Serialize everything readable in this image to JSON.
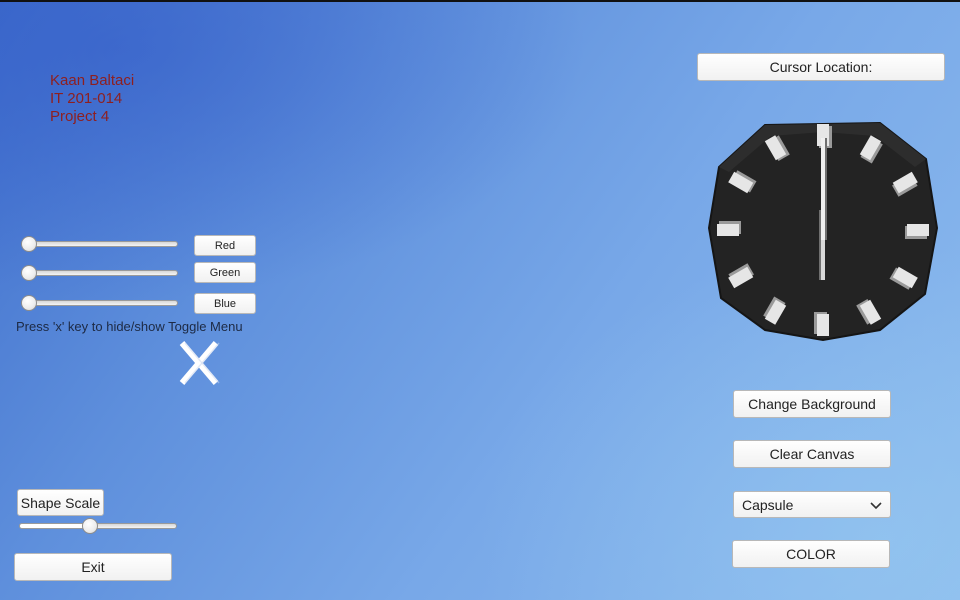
{
  "author": {
    "name": "Kaan Baltaci",
    "course": "IT 201-014",
    "project": "Project 4"
  },
  "color_sliders": [
    {
      "label": "Red",
      "value": 0
    },
    {
      "label": "Green",
      "value": 0
    },
    {
      "label": "Blue",
      "value": 0
    }
  ],
  "hint_text": "Press 'x' key to hide/show Toggle Menu",
  "shape_scale": {
    "label": "Shape Scale",
    "value": 0.45
  },
  "exit_label": "Exit",
  "cursor_location_label": "Cursor Location:",
  "buttons": {
    "change_background": "Change Background",
    "clear_canvas": "Clear Canvas",
    "color": "COLOR"
  },
  "shape_dropdown": {
    "selected": "Capsule"
  },
  "clock": {
    "hour": 6,
    "minute": 0,
    "face_color": "#232323",
    "marker_color": "#e6e6e6"
  },
  "colors": {
    "author_text": "#8e1f1f",
    "background_start": "#3f6ecc",
    "background_end": "#8dbcee"
  },
  "icons": {
    "toggle_menu": "close-x-icon",
    "dropdown": "chevron-down-icon"
  }
}
